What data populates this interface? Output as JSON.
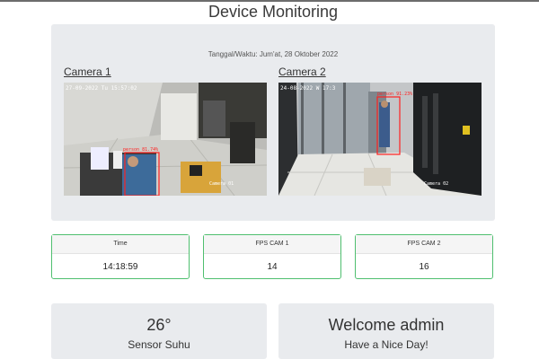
{
  "page": {
    "title": "Device Monitoring"
  },
  "camera_panel": {
    "datetime": "Tanggal/Waktu: Jum'at, 28 Oktober 2022",
    "cameras": [
      {
        "title": "Camera 1",
        "timestamp": "27-09-2022 Tu 15:57:02",
        "label": "Camera 01",
        "detection": "person 81.74%"
      },
      {
        "title": "Camera 2",
        "timestamp": "24-08-2022 W 17:3",
        "label": "Camera 02",
        "detection": "person 91.23%"
      }
    ]
  },
  "stats": [
    {
      "header": "Time",
      "value": "14:18:59"
    },
    {
      "header": "FPS CAM 1",
      "value": "14"
    },
    {
      "header": "FPS CAM 2",
      "value": "16"
    }
  ],
  "sensor": {
    "value": "26°",
    "label": "Sensor Suhu"
  },
  "welcome": {
    "title": "Welcome admin",
    "subtitle": "Have a Nice Day!"
  },
  "colors": {
    "card_border": "#4fbf6f",
    "panel_bg": "#e9ebee",
    "detection_box": "#ff2020"
  }
}
